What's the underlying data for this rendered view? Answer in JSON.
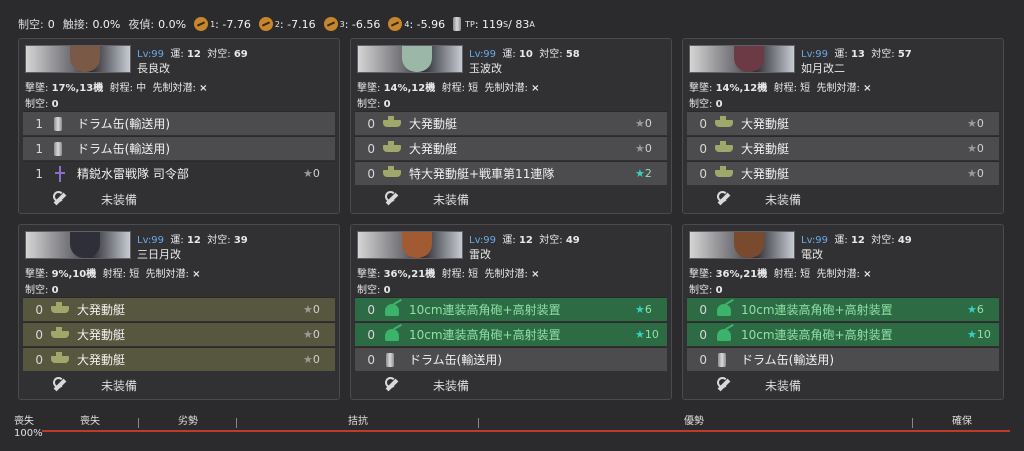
{
  "topbar": {
    "items": [
      {
        "label": "制空:",
        "value": "0"
      },
      {
        "label": "触接:",
        "value": "0.0%"
      },
      {
        "label": "夜偵:",
        "value": "0.0%"
      }
    ],
    "fleet_ac": [
      {
        "sub": "1",
        "value": ": -7.76"
      },
      {
        "sub": "2",
        "value": ": -7.16"
      },
      {
        "sub": "3",
        "value": ": -6.56"
      },
      {
        "sub": "4",
        "value": ": -5.96"
      }
    ],
    "tp": {
      "sub": "TP",
      "value": ": 119",
      "s_sub": "S",
      "slash": " / 83",
      "a_sub": "A"
    }
  },
  "ships": [
    {
      "lv": "Lv:99",
      "luck_label": "運:",
      "luck": "12",
      "aa_label": "対空:",
      "aa": "69",
      "name": "長良改",
      "evasion_label": "撃墜:",
      "evasion": "17%,13機",
      "range_label": "射程:",
      "range": "中",
      "asw_label": "先制対潜:",
      "asw": "×",
      "ac_label": "制空:",
      "ac": "0",
      "equip": [
        {
          "count": "1",
          "icon": "drum-icon",
          "name": "ドラム缶(輸送用)",
          "star": "",
          "style": "gray"
        },
        {
          "count": "1",
          "icon": "drum-icon",
          "name": "ドラム缶(輸送用)",
          "star": "",
          "style": "gray"
        },
        {
          "count": "1",
          "icon": "submarine-icon",
          "name": "精鋭水雷戦隊 司令部",
          "star": "0",
          "style": "none"
        }
      ],
      "unequip": "未装備",
      "face": "#7a5a46"
    },
    {
      "lv": "Lv:99",
      "luck_label": "運:",
      "luck": "10",
      "aa_label": "対空:",
      "aa": "58",
      "name": "玉波改",
      "evasion_label": "撃墜:",
      "evasion": "14%,12機",
      "range_label": "射程:",
      "range": "短",
      "asw_label": "先制対潜:",
      "asw": "×",
      "ac_label": "制空:",
      "ac": "0",
      "equip": [
        {
          "count": "0",
          "icon": "landing-craft-icon",
          "name": "大発動艇",
          "star": "0",
          "style": "gray"
        },
        {
          "count": "0",
          "icon": "landing-craft-icon",
          "name": "大発動艇",
          "star": "0",
          "style": "gray"
        },
        {
          "count": "0",
          "icon": "landing-craft-icon",
          "name": "特大発動艇+戦車第11連隊",
          "star": "2",
          "style": "gray"
        }
      ],
      "unequip": "未装備",
      "face": "#9ab7a8"
    },
    {
      "lv": "Lv:99",
      "luck_label": "運:",
      "luck": "13",
      "aa_label": "対空:",
      "aa": "57",
      "name": "如月改二",
      "evasion_label": "撃墜:",
      "evasion": "14%,12機",
      "range_label": "射程:",
      "range": "短",
      "asw_label": "先制対潜:",
      "asw": "×",
      "ac_label": "制空:",
      "ac": "0",
      "equip": [
        {
          "count": "0",
          "icon": "landing-craft-icon",
          "name": "大発動艇",
          "star": "0",
          "style": "gray"
        },
        {
          "count": "0",
          "icon": "landing-craft-icon",
          "name": "大発動艇",
          "star": "0",
          "style": "gray"
        },
        {
          "count": "0",
          "icon": "landing-craft-icon",
          "name": "大発動艇",
          "star": "0",
          "style": "gray"
        }
      ],
      "unequip": "未装備",
      "face": "#6b3a44"
    },
    {
      "lv": "Lv:99",
      "luck_label": "運:",
      "luck": "12",
      "aa_label": "対空:",
      "aa": "39",
      "name": "三日月改",
      "evasion_label": "撃墜:",
      "evasion": "9%,10機",
      "range_label": "射程:",
      "range": "短",
      "asw_label": "先制対潜:",
      "asw": "×",
      "ac_label": "制空:",
      "ac": "0",
      "equip": [
        {
          "count": "0",
          "icon": "landing-craft-icon",
          "name": "大発動艇",
          "star": "0",
          "style": "olive"
        },
        {
          "count": "0",
          "icon": "landing-craft-icon",
          "name": "大発動艇",
          "star": "0",
          "style": "olive"
        },
        {
          "count": "0",
          "icon": "landing-craft-icon",
          "name": "大発動艇",
          "star": "0",
          "style": "olive"
        }
      ],
      "unequip": "未装備",
      "face": "#2f2f3a"
    },
    {
      "lv": "Lv:99",
      "luck_label": "運:",
      "luck": "12",
      "aa_label": "対空:",
      "aa": "49",
      "name": "雷改",
      "evasion_label": "撃墜:",
      "evasion": "36%,21機",
      "range_label": "射程:",
      "range": "短",
      "asw_label": "先制対潜:",
      "asw": "×",
      "ac_label": "制空:",
      "ac": "0",
      "equip": [
        {
          "count": "0",
          "icon": "aa-gun-icon",
          "name": "10cm連装高角砲+高射装置",
          "star": "6",
          "style": "green"
        },
        {
          "count": "0",
          "icon": "aa-gun-icon",
          "name": "10cm連装高角砲+高射装置",
          "star": "10",
          "style": "green"
        },
        {
          "count": "0",
          "icon": "drum-icon",
          "name": "ドラム缶(輸送用)",
          "star": "",
          "style": "gray"
        }
      ],
      "unequip": "未装備",
      "face": "#a15a32"
    },
    {
      "lv": "Lv:99",
      "luck_label": "運:",
      "luck": "12",
      "aa_label": "対空:",
      "aa": "49",
      "name": "電改",
      "evasion_label": "撃墜:",
      "evasion": "36%,21機",
      "range_label": "射程:",
      "range": "短",
      "asw_label": "先制対潜:",
      "asw": "×",
      "ac_label": "制空:",
      "ac": "0",
      "equip": [
        {
          "count": "0",
          "icon": "aa-gun-icon",
          "name": "10cm連装高角砲+高射装置",
          "star": "6",
          "style": "green"
        },
        {
          "count": "0",
          "icon": "aa-gun-icon",
          "name": "10cm連装高角砲+高射装置",
          "star": "10",
          "style": "green"
        },
        {
          "count": "0",
          "icon": "drum-icon",
          "name": "ドラム缶(輸送用)",
          "star": "",
          "style": "gray"
        }
      ],
      "unequip": "未装備",
      "face": "#7a4a2e"
    }
  ],
  "air_bar": {
    "labels": [
      "喪失",
      "喪失",
      "劣勢",
      "拮抗",
      "優勢",
      "確保"
    ],
    "percent": "100%",
    "color": "#c0392b"
  }
}
